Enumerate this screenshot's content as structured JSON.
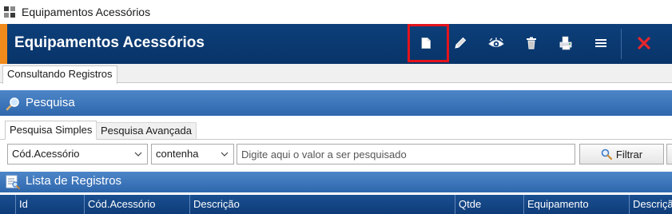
{
  "window": {
    "title": "Equipamentos Acessórios",
    "icon": "app-icon"
  },
  "header": {
    "title": "Equipamentos Acessórios",
    "accent_color": "#f08a1a",
    "background_color": "#0d3f7a",
    "toolbar": [
      {
        "name": "new-record-button",
        "icon": "document-icon",
        "highlighted": true
      },
      {
        "name": "edit-button",
        "icon": "pencil-icon"
      },
      {
        "name": "view-button",
        "icon": "eye-icon"
      },
      {
        "name": "delete-button",
        "icon": "trash-icon"
      },
      {
        "name": "print-button",
        "icon": "printer-icon"
      },
      {
        "name": "menu-button",
        "icon": "hamburger-menu-icon"
      },
      {
        "name": "close-button",
        "icon": "close-icon"
      }
    ],
    "highlight_color": "#e3141c"
  },
  "tabs": {
    "active": "Consultando Registros"
  },
  "search_section": {
    "title": "Pesquisa",
    "icon": "magnifier-icon",
    "tabs": [
      "Pesquisa Simples",
      "Pesquisa Avançada"
    ],
    "active_tab": "Pesquisa Simples",
    "field_select": {
      "value": "Cód.Acessório"
    },
    "operator_select": {
      "value": "contenha"
    },
    "search_input": {
      "value": "",
      "placeholder": "Digite aqui o valor a ser pesquisado"
    },
    "filter_button": "Filtrar"
  },
  "list_section": {
    "title": "Lista de Registros",
    "icon": "list-icon",
    "columns": [
      "Id",
      "Cód.Acessório",
      "Descrição",
      "Qtde",
      "Equipamento",
      "Descriçã"
    ]
  }
}
